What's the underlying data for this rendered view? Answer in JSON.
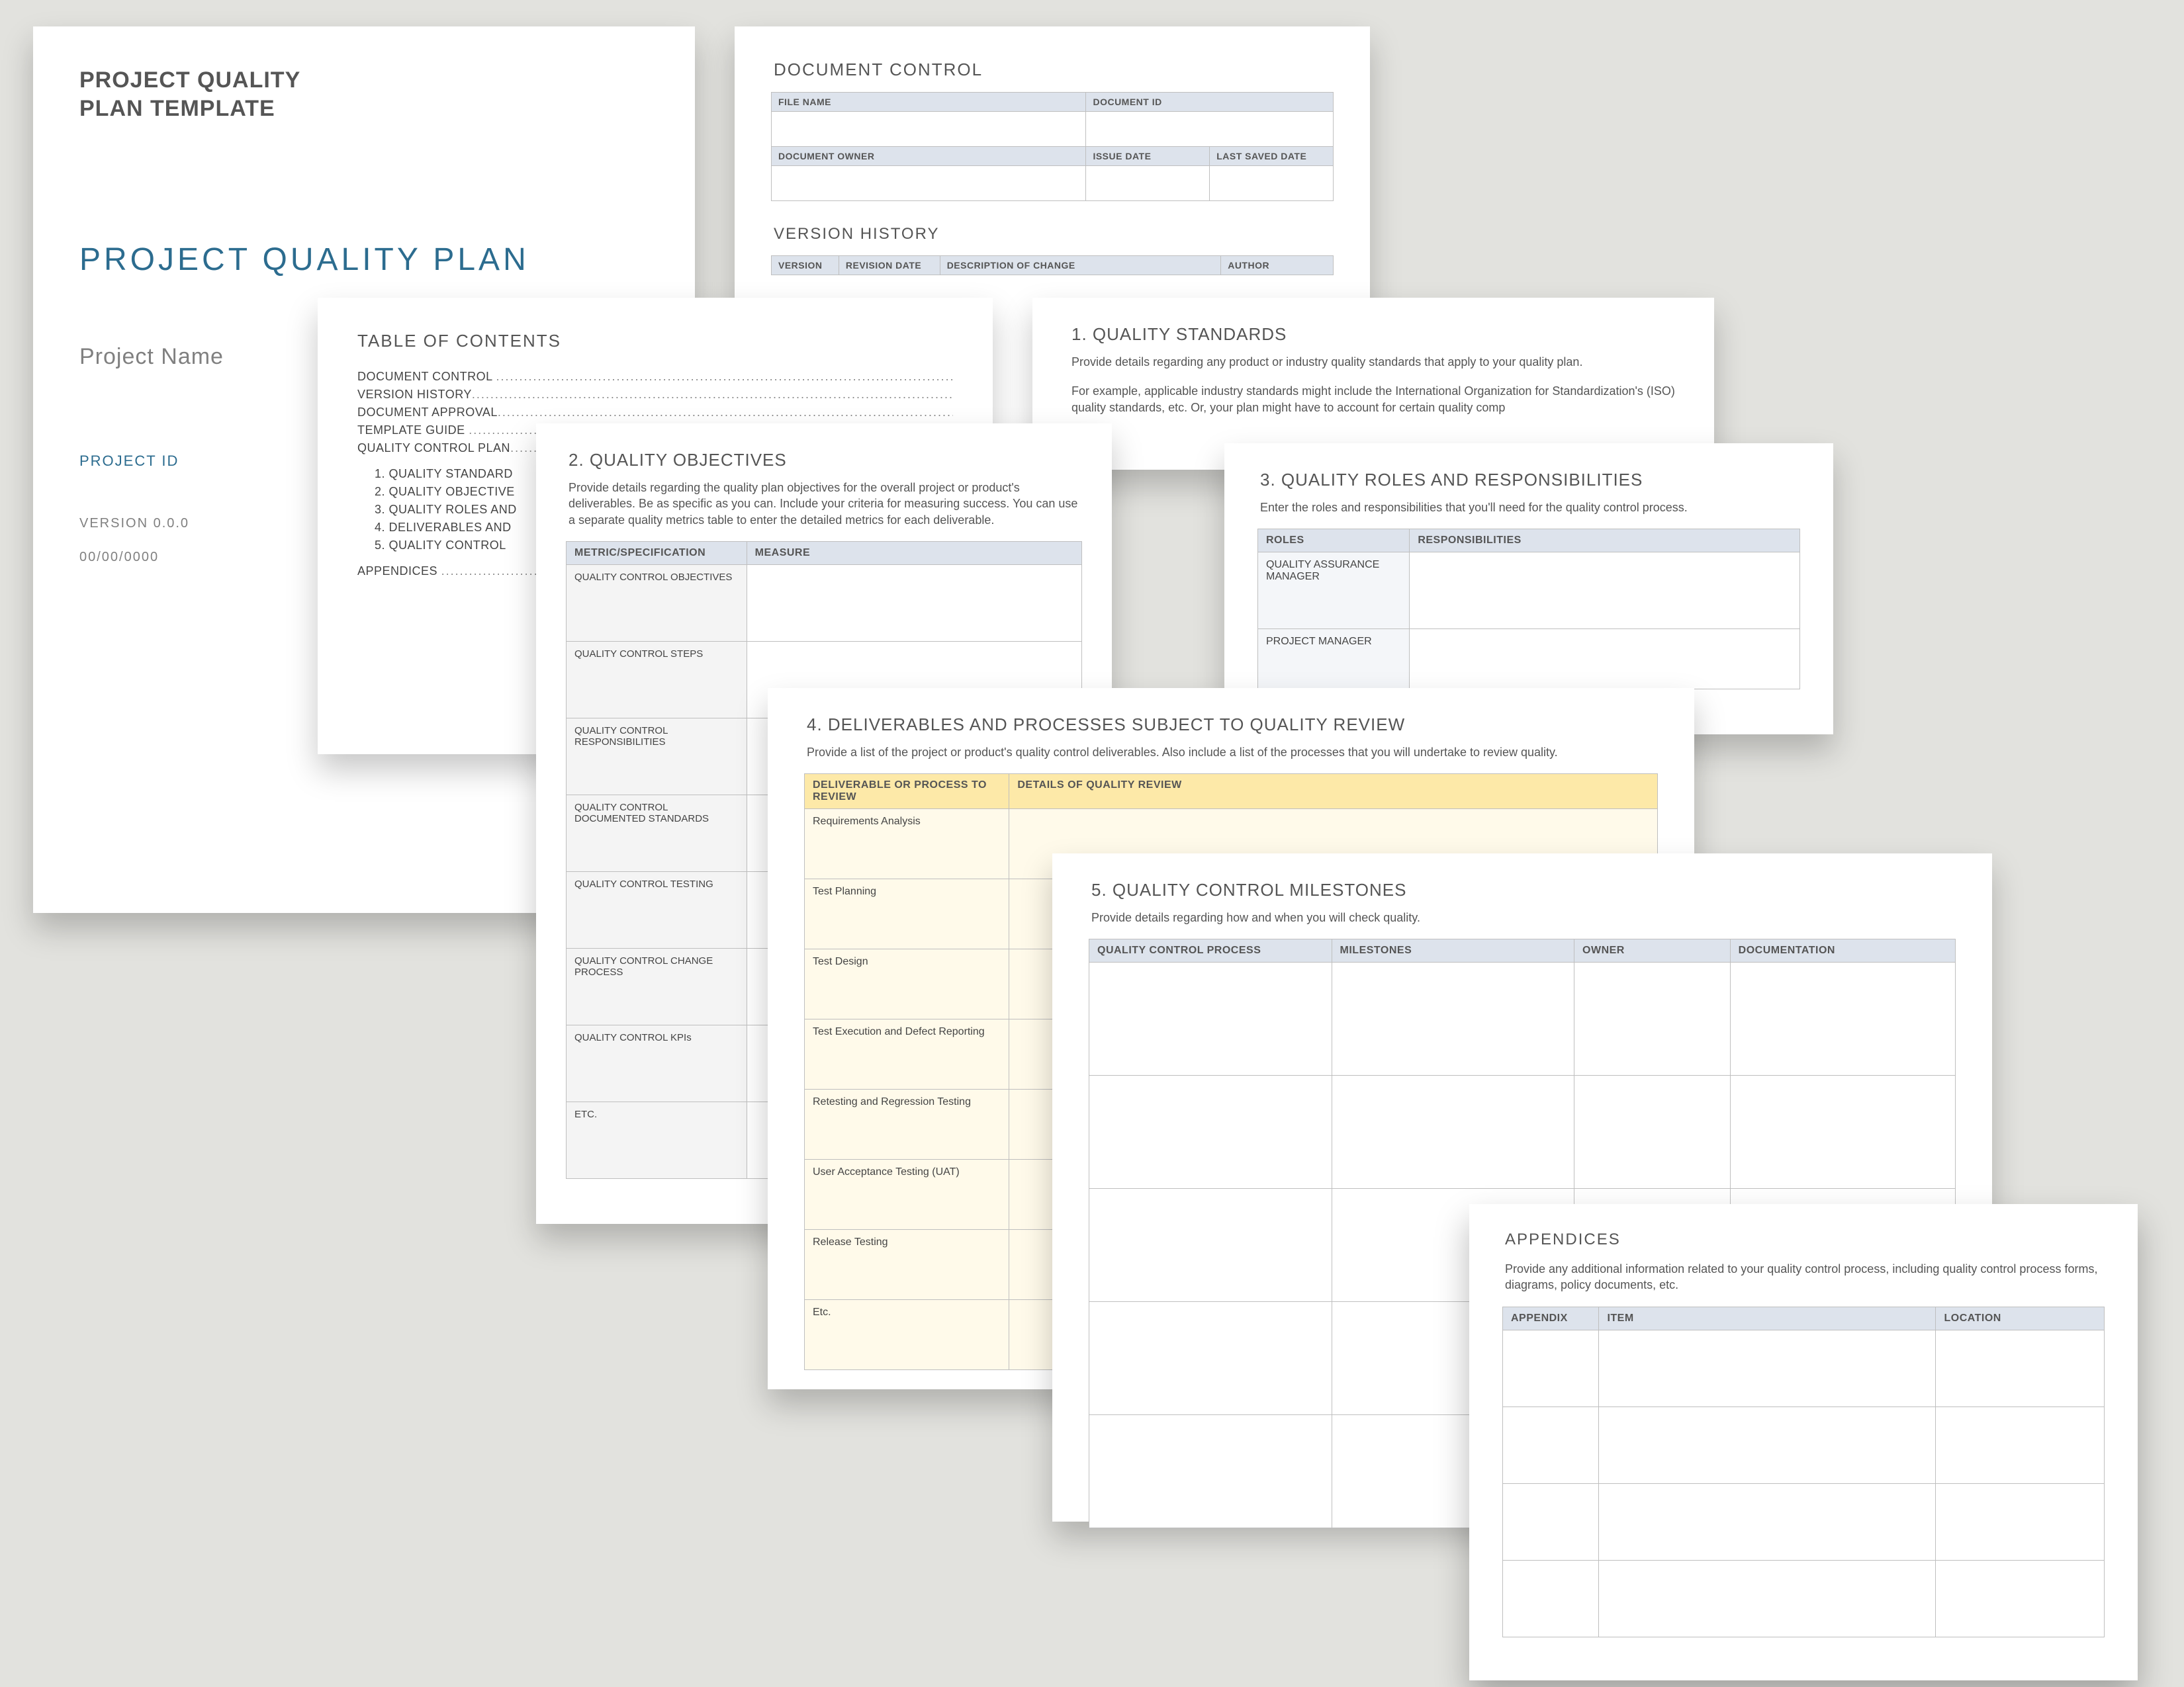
{
  "cover": {
    "template_title_l1": "PROJECT QUALITY",
    "template_title_l2": "PLAN TEMPLATE",
    "doc_title": "PROJECT QUALITY PLAN",
    "project_name_label": "Project Name",
    "project_id_label": "PROJECT ID",
    "version_label": "VERSION 0.0.0",
    "date_label": "00/00/0000"
  },
  "doc_control": {
    "heading": "DOCUMENT CONTROL",
    "file_name_h": "FILE NAME",
    "doc_id_h": "DOCUMENT ID",
    "doc_owner_h": "DOCUMENT OWNER",
    "issue_date_h": "ISSUE DATE",
    "last_saved_h": "LAST SAVED DATE",
    "version_history_h": "VERSION HISTORY",
    "vh_version": "VERSION",
    "vh_revdate": "REVISION DATE",
    "vh_desc": "DESCRIPTION OF CHANGE",
    "vh_author": "AUTHOR"
  },
  "toc": {
    "heading": "TABLE OF CONTENTS",
    "lines": [
      "DOCUMENT CONTROL",
      "VERSION HISTORY",
      "DOCUMENT APPROVAL",
      "TEMPLATE GUIDE",
      "QUALITY CONTROL PLAN"
    ],
    "numbered": [
      "1.   QUALITY STANDARD",
      "2.   QUALITY OBJECTIVE",
      "3.   QUALITY ROLES AND",
      "4.   DELIVERABLES AND",
      "5.   QUALITY CONTROL"
    ],
    "appendices": "APPENDICES"
  },
  "s1": {
    "heading": "1.  QUALITY STANDARDS",
    "desc1": "Provide details regarding any product or industry quality standards that apply to your quality plan.",
    "desc2": "For example, applicable industry standards might include the International Organization for Standardization's (ISO) quality standards, etc. Or, your plan might have to account for certain quality comp"
  },
  "s2": {
    "heading": "2.  QUALITY OBJECTIVES",
    "desc": "Provide details regarding the quality plan objectives for the overall project or product's deliverables. Be as specific as you can. Include your criteria for measuring success. You can use a separate quality metrics table to enter the detailed metrics for each deliverable.",
    "col_metric": "METRIC/SPECIFICATION",
    "col_measure": "MEASURE",
    "rows": [
      "QUALITY CONTROL OBJECTIVES",
      "QUALITY CONTROL STEPS",
      "QUALITY CONTROL RESPONSIBILITIES",
      "QUALITY CONTROL DOCUMENTED STANDARDS",
      "QUALITY CONTROL TESTING",
      "QUALITY CONTROL CHANGE PROCESS",
      "QUALITY CONTROL KPIs",
      "ETC."
    ]
  },
  "s3": {
    "heading": "3.  QUALITY ROLES AND RESPONSIBILITIES",
    "desc": "Enter the roles and responsibilities that you'll need for the quality control process.",
    "col_roles": "ROLES",
    "col_resp": "RESPONSIBILITIES",
    "rows": [
      "QUALITY ASSURANCE MANAGER",
      "PROJECT MANAGER"
    ]
  },
  "s4": {
    "heading": "4.   DELIVERABLES AND PROCESSES SUBJECT TO QUALITY REVIEW",
    "desc": "Provide a list of the project or product's quality control deliverables. Also include a list of the processes that you will undertake to review quality.",
    "col1": "DELIVERABLE OR PROCESS TO REVIEW",
    "col2": "DETAILS OF QUALITY REVIEW",
    "rows": [
      "Requirements Analysis",
      "Test Planning",
      "Test Design",
      "Test Execution and Defect Reporting",
      "Retesting and Regression Testing",
      "User Acceptance Testing (UAT)",
      "Release Testing",
      "Etc."
    ]
  },
  "s5": {
    "heading": "5.  QUALITY CONTROL MILESTONES",
    "desc": "Provide details regarding how and when you will check quality.",
    "col_process": "QUALITY CONTROL PROCESS",
    "col_milestones": "MILESTONES",
    "col_owner": "OWNER",
    "col_doc": "DOCUMENTATION"
  },
  "appendices": {
    "heading": "APPENDICES",
    "desc": "Provide any additional information related to your quality control process, including quality control process forms, diagrams, policy documents, etc.",
    "col_appendix": "APPENDIX",
    "col_item": "ITEM",
    "col_location": "LOCATION"
  }
}
